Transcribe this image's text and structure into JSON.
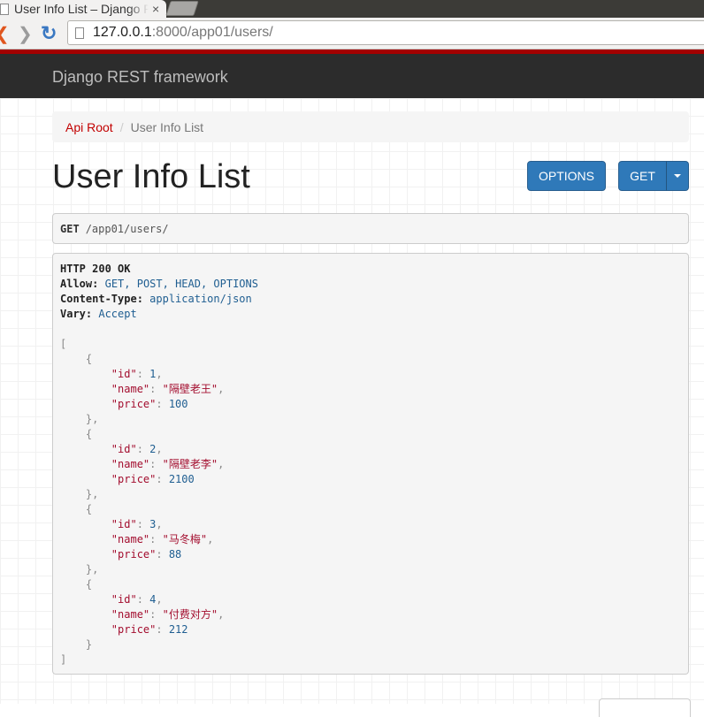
{
  "browser": {
    "tab_title": "User Info List – Django REST framework",
    "tab_close": "×",
    "url_host": "127.0.0.1",
    "url_rest": ":8000/app01/users/"
  },
  "navbar": {
    "brand": "Django REST framework"
  },
  "breadcrumb": {
    "root": "Api Root",
    "separator": "/",
    "current": "User Info List"
  },
  "page": {
    "title": "User Info List"
  },
  "buttons": {
    "options": "OPTIONS",
    "get": "GET"
  },
  "request": {
    "method": "GET",
    "path": "/app01/users/"
  },
  "response": {
    "status": "HTTP 200 OK",
    "headers": [
      {
        "key": "Allow:",
        "value": "GET, POST, HEAD, OPTIONS"
      },
      {
        "key": "Content-Type:",
        "value": "application/json"
      },
      {
        "key": "Vary:",
        "value": "Accept"
      }
    ],
    "items": [
      {
        "id": "1",
        "name": "\"隔壁老王\"",
        "price": "100"
      },
      {
        "id": "2",
        "name": "\"隔壁老李\"",
        "price": "2100"
      },
      {
        "id": "3",
        "name": "\"马冬梅\"",
        "price": "88"
      },
      {
        "id": "4",
        "name": "\"付费对方\"",
        "price": "212"
      }
    ]
  },
  "colors": {
    "navbar": "#2c2c2c",
    "accent": "#a30000",
    "button": "#2f79b9",
    "link": "#c20000"
  },
  "icons": [
    "back-arrow-icon",
    "forward-arrow-icon",
    "reload-icon",
    "page-icon",
    "caret-down-icon"
  ]
}
